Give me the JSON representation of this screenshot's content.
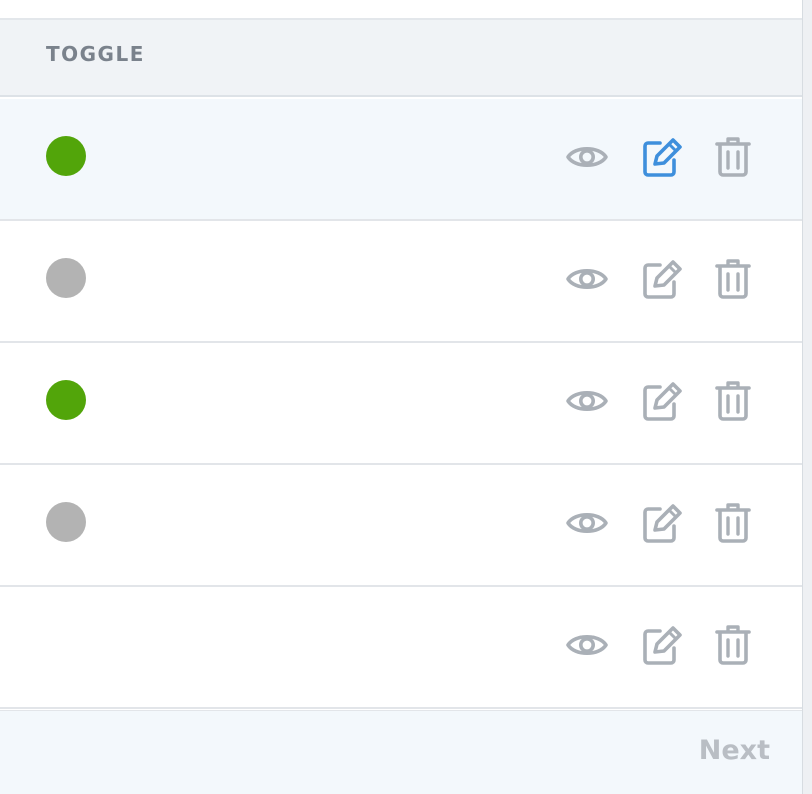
{
  "header": {
    "column_label": "TOGGLE"
  },
  "colors": {
    "toggle_on": "#52a50a",
    "toggle_off": "#b3b3b3",
    "icon_default": "#aab0b7",
    "icon_active": "#3e8fdc"
  },
  "rows": [
    {
      "toggle": "on",
      "hovered": true,
      "active_action": "edit"
    },
    {
      "toggle": "off",
      "hovered": false,
      "active_action": null
    },
    {
      "toggle": "on",
      "hovered": false,
      "active_action": null
    },
    {
      "toggle": "off",
      "hovered": false,
      "active_action": null
    },
    {
      "toggle": null,
      "hovered": false,
      "active_action": null
    }
  ],
  "row_actions": [
    {
      "name": "view",
      "icon": "eye-icon"
    },
    {
      "name": "edit",
      "icon": "edit-icon"
    },
    {
      "name": "delete",
      "icon": "trash-icon"
    }
  ],
  "pagination": {
    "next_label": "Next"
  }
}
